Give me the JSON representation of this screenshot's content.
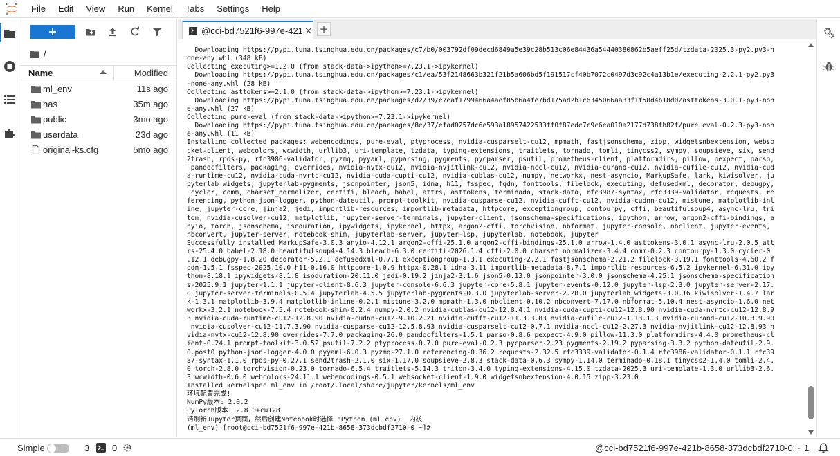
{
  "menubar": {
    "items": [
      "File",
      "Edit",
      "View",
      "Run",
      "Kernel",
      "Tabs",
      "Settings",
      "Help"
    ]
  },
  "filebrowser": {
    "new_label": "+",
    "breadcrumb": "/",
    "columns": {
      "name": "Name",
      "modified": "Modified"
    },
    "files": [
      {
        "name": "ml_env",
        "modified": "11s ago",
        "type": "folder"
      },
      {
        "name": "nas",
        "modified": "35m ago",
        "type": "folder"
      },
      {
        "name": "public",
        "modified": "3mo ago",
        "type": "folder"
      },
      {
        "name": "userdata",
        "modified": "23d ago",
        "type": "folder"
      },
      {
        "name": "original-ks.cfg",
        "modified": "5mo ago",
        "type": "file"
      }
    ]
  },
  "tabs": {
    "active_label": "@cci-bd7521f6-997e-421b",
    "close": "×",
    "add": "+"
  },
  "terminal": {
    "lines": [
      "  Downloading https://pypi.tuna.tsinghua.edu.cn/packages/c7/b0/003792df09decd6849a5e39c28b513c06e84436a54440380862b5aeff25d/tzdata-2025.3-py2.py3-n",
      "one-any.whl (348 kB)",
      "Collecting executing>=1.2.0 (from stack-data->ipython>=7.23.1->ipykernel)",
      "  Downloading https://pypi.tuna.tsinghua.edu.cn/packages/c1/ea/53f2148663b321f21b5a606bd5f191517cf40b7072c0497d3c92c4a13b1e/executing-2.2.1-py2.py3",
      "-none-any.whl (28 kB)",
      "Collecting asttokens>=2.1.0 (from stack-data->ipython>=7.23.1->ipykernel)",
      "  Downloading https://pypi.tuna.tsinghua.edu.cn/packages/d2/39/e7eaf1799466a4aef85b6a4fe7bd175ad2b1c6345066aa33f1f58d4b18d0/asttokens-3.0.1-py3-non",
      "e-any.whl (27 kB)",
      "Collecting pure-eval (from stack-data->ipython>=7.23.1->ipykernel)",
      "  Downloading https://pypi.tuna.tsinghua.edu.cn/packages/8e/37/efad0257dc6e593a18957422533ff0f87ede7c9c6ea010a2177d738fb82f/pure_eval-0.2.3-py3-non",
      "e-any.whl (11 kB)",
      "Installing collected packages: webencodings, pure-eval, ptyprocess, nvidia-cusparselt-cu12, mpmath, fastjsonschema, zipp, widgetsnbextension, webso",
      "cket-client, webcolors, wcwidth, urllib3, uri-template, tzdata, typing-extensions, traitlets, tornado, tomli, tinycss2, sympy, soupsieve, six, send",
      "2trash, rpds-py, rfc3986-validator, pyzmq, pyyaml, pyparsing, pygments, pycparser, psutil, prometheus-client, platformdirs, pillow, pexpect, parso,",
      " pandocfilters, packaging, overrides, nvidia-nvtx-cu12, nvidia-nvjitlink-cu12, nvidia-nccl-cu12, nvidia-curand-cu12, nvidia-cufile-cu12, nvidia-cud",
      "a-runtime-cu12, nvidia-cuda-nvrtc-cu12, nvidia-cuda-cupti-cu12, nvidia-cublas-cu12, numpy, networkx, nest-asyncio, MarkupSafe, lark, kiwisolver, ju",
      "pyterlab_widgets, jupyterlab-pygments, jsonpointer, json5, idna, h11, fsspec, fqdn, fonttools, filelock, executing, defusedxml, decorator, debugpy,",
      " cycler, comm, charset_normalizer, certifi, bleach, babel, attrs, asttokens, terminado, stack-data, rfc3987-syntax, rfc3339-validator, requests, re",
      "ferencing, python-json-logger, python-dateutil, prompt-toolkit, nvidia-cusparse-cu12, nvidia-cufft-cu12, nvidia-cudnn-cu12, mistune, matplotlib-inl",
      "ine, jupyter-core, jinja2, jedi, importlib-resources, importlib-metadata, httpcore, exceptiongroup, contourpy, cffi, beautifulsoup4, async-lru, tri",
      "ton, nvidia-cusolver-cu12, matplotlib, jupyter-server-terminals, jupyter-client, jsonschema-specifications, ipython, arrow, argon2-cffi-bindings, a",
      "nyio, torch, jsonschema, isoduration, ipywidgets, ipykernel, httpx, argon2-cffi, torchvision, nbformat, jupyter-console, nbclient, jupyter-events,",
      "nbconvert, jupyter-server, notebook-shim, jupyterlab-server, jupyter-lsp, jupyterlab, notebook, jupyter",
      "Successfully installed MarkupSafe-3.0.3 anyio-4.12.1 argon2-cffi-25.1.0 argon2-cffi-bindings-25.1.0 arrow-1.4.0 asttokens-3.0.1 async-lru-2.0.5 att",
      "rs-25.4.0 babel-2.18.0 beautifulsoup4-4.14.3 bleach-6.3.0 certifi-2026.1.4 cffi-2.0.0 charset_normalizer-3.4.4 comm-0.2.3 contourpy-1.3.0 cycler-0",
      ".12.1 debugpy-1.8.20 decorator-5.2.1 defusedxml-0.7.1 exceptiongroup-1.3.1 executing-2.2.1 fastjsonschema-2.21.2 filelock-3.19.1 fonttools-4.60.2 f",
      "qdn-1.5.1 fsspec-2025.10.0 h11-0.16.0 httpcore-1.0.9 httpx-0.28.1 idna-3.11 importlib-metadata-8.7.1 importlib-resources-6.5.2 ipykernel-6.31.0 ipy",
      "thon-8.18.1 ipywidgets-8.1.8 isoduration-20.11.0 jedi-0.19.2 jinja2-3.1.6 json5-0.13.0 jsonpointer-3.0.0 jsonschema-4.25.1 jsonschema-specification",
      "s-2025.9.1 jupyter-1.1.1 jupyter-client-8.6.3 jupyter-console-6.6.3 jupyter-core-5.8.1 jupyter-events-0.12.0 jupyter-lsp-2.3.0 jupyter-server-2.17.",
      "0 jupyter-server-terminals-0.5.4 jupyterlab-4.5.5 jupyterlab-pygments-0.3.0 jupyterlab-server-2.28.0 jupyterlab_widgets-3.0.16 kiwisolver-1.4.7 lar",
      "k-1.3.1 matplotlib-3.9.4 matplotlib-inline-0.2.1 mistune-3.2.0 mpmath-1.3.0 nbclient-0.10.2 nbconvert-7.17.0 nbformat-5.10.4 nest-asyncio-1.6.0 net",
      "workx-3.2.1 notebook-7.5.4 notebook-shim-0.2.4 numpy-2.0.2 nvidia-cublas-cu12-12.8.4.1 nvidia-cuda-cupti-cu12-12.8.90 nvidia-cuda-nvrtc-cu12-12.8.9",
      "3 nvidia-cuda-runtime-cu12-12.8.90 nvidia-cudnn-cu12-9.10.2.21 nvidia-cufft-cu12-11.3.3.83 nvidia-cufile-cu12-1.13.1.3 nvidia-curand-cu12-10.3.9.90",
      " nvidia-cusolver-cu12-11.7.3.90 nvidia-cusparse-cu12-12.5.8.93 nvidia-cusparselt-cu12-0.7.1 nvidia-nccl-cu12-2.27.3 nvidia-nvjitlink-cu12-12.8.93 n",
      "vidia-nvtx-cu12-12.8.90 overrides-7.7.0 packaging-26.0 pandocfilters-1.5.1 parso-0.8.6 pexpect-4.9.0 pillow-11.3.0 platformdirs-4.4.0 prometheus-cl",
      "ient-0.24.1 prompt-toolkit-3.0.52 psutil-7.2.2 ptyprocess-0.7.0 pure-eval-0.2.3 pycparser-2.23 pygments-2.19.2 pyparsing-3.3.2 python-dateutil-2.9.",
      "0.post0 python-json-logger-4.0.0 pyyaml-6.0.3 pyzmq-27.1.0 referencing-0.36.2 requests-2.32.5 rfc3339-validator-0.1.4 rfc3986-validator-0.1.1 rfc39",
      "87-syntax-1.1.0 rpds-py-0.27.1 send2trash-2.1.0 six-1.17.0 soupsieve-2.8.3 stack-data-0.6.3 sympy-1.14.0 terminado-0.18.1 tinycss2-1.4.0 tomli-2.4.",
      "0 torch-2.8.0 torchvision-0.23.0 tornado-6.5.4 traitlets-5.14.3 triton-3.4.0 typing-extensions-4.15.0 tzdata-2025.3 uri-template-1.3.0 urllib3-2.6.",
      "3 wcwidth-0.6.0 webcolors-24.11.1 webencodings-0.5.1 websocket-client-1.9.0 widgetsnbextension-4.0.15 zipp-3.23.0",
      "Installed kernelspec ml_env in /root/.local/share/jupyter/kernels/ml_env",
      "环境配置完成!",
      "NumPy版本: 2.0.2",
      "PyTorch版本: 2.8.0+cu128",
      "请刷新Jupyter页面，然后创建Notebook时选择 'Python (ml_env)' 内核",
      "(ml_env) [root@cci-bd7521f6-997e-421b-8658-373dcbdf2710-0 ~]# "
    ]
  },
  "statusbar": {
    "mode_label": "Simple",
    "terminals_count": "3",
    "kernels_count": "0",
    "host": "@cci-bd7521f6-997e-421b-8658-373dcbdf2710-0:~",
    "notifications": "1"
  },
  "colors": {
    "accent": "#1976d2",
    "logo_orange": "#f37726"
  }
}
